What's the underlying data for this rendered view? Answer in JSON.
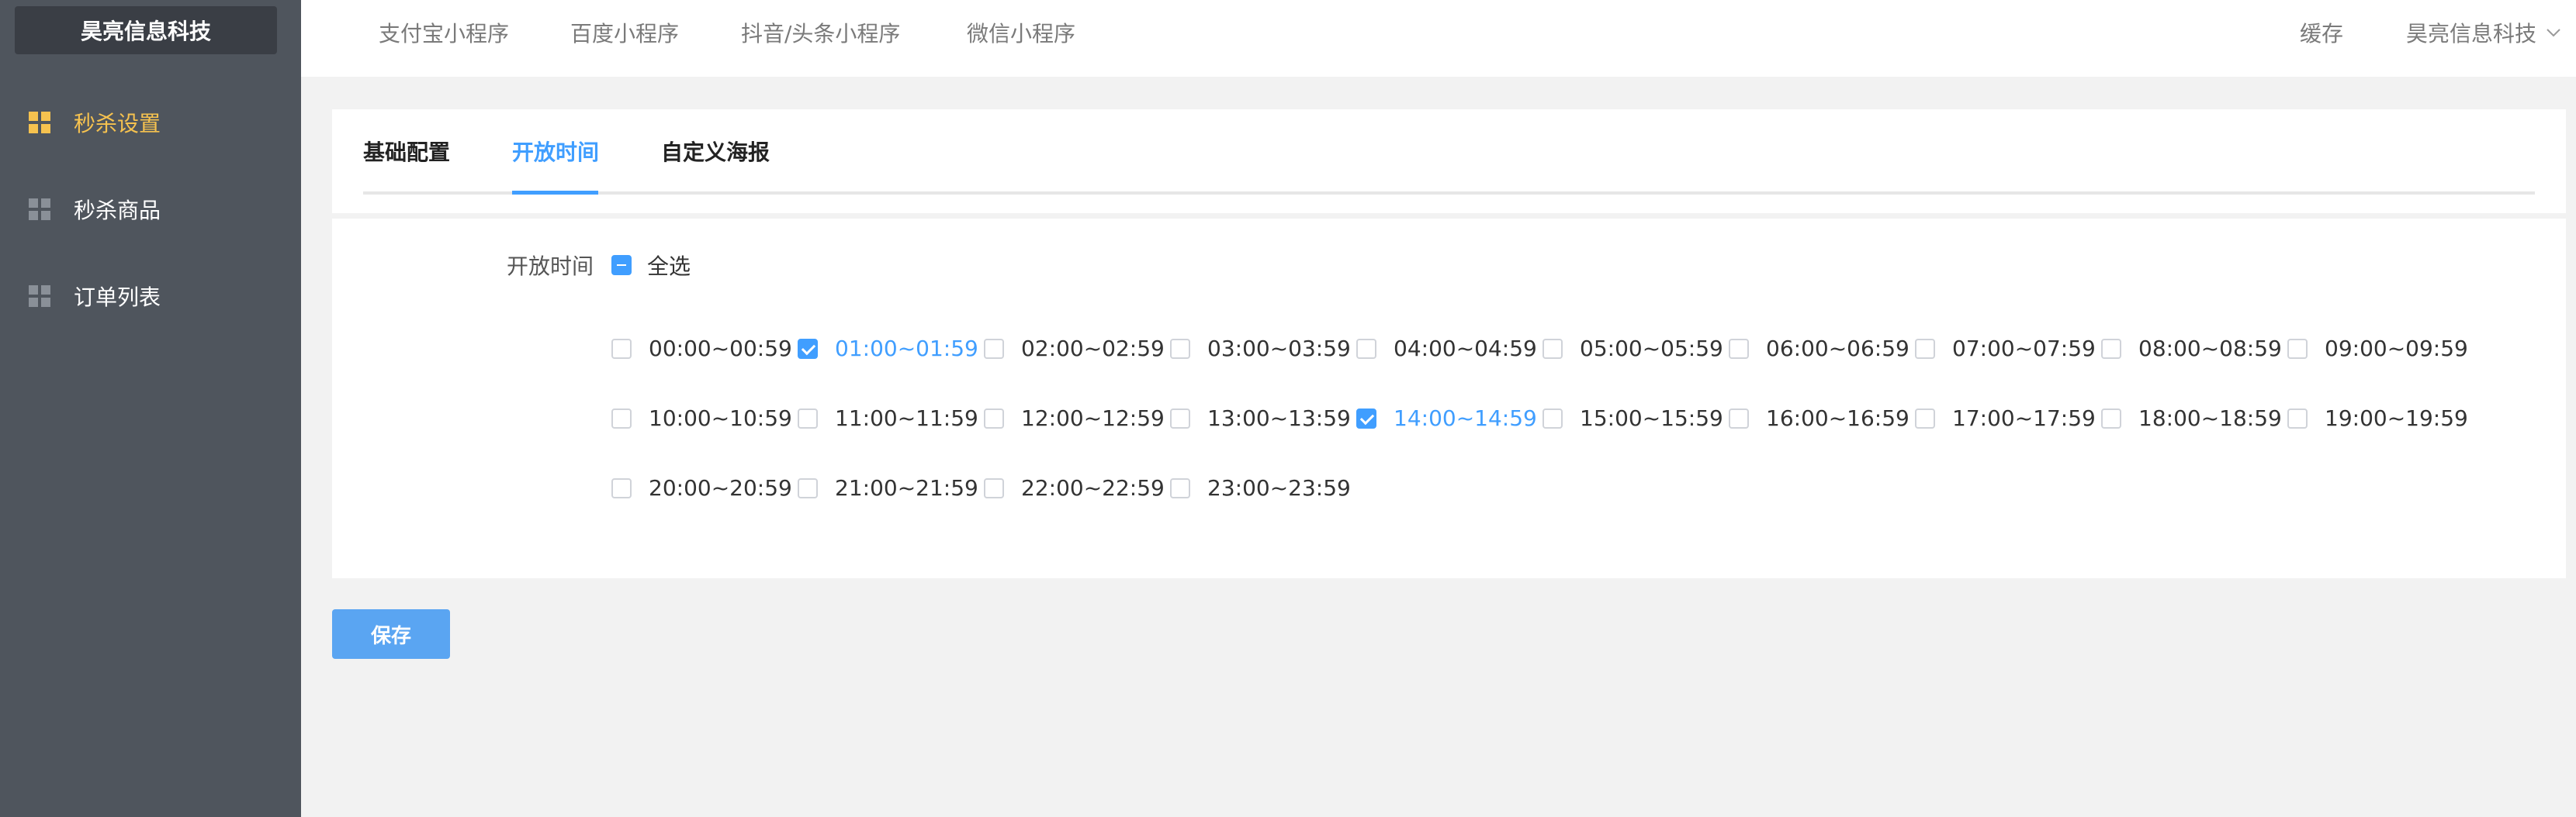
{
  "sidebar": {
    "brand": "昊亮信息科技",
    "items": [
      {
        "label": "秒杀设置",
        "icon": "grid-icon",
        "active": true
      },
      {
        "label": "秒杀商品",
        "icon": "grid-icon",
        "active": false
      },
      {
        "label": "订单列表",
        "icon": "grid-icon",
        "active": false
      }
    ]
  },
  "topbar": {
    "links": [
      "支付宝小程序",
      "百度小程序",
      "抖音/头条小程序",
      "微信小程序"
    ],
    "cache": "缓存",
    "user": "昊亮信息科技",
    "user_icon": "chevron-down-icon"
  },
  "tabs": [
    {
      "label": "基础配置",
      "active": false
    },
    {
      "label": "开放时间",
      "active": true
    },
    {
      "label": "自定义海报",
      "active": false
    }
  ],
  "form": {
    "label": "开放时间",
    "check_all": "全选",
    "check_all_state": "indeterminate",
    "slots": [
      {
        "label": "00:00~00:59",
        "checked": false
      },
      {
        "label": "01:00~01:59",
        "checked": true
      },
      {
        "label": "02:00~02:59",
        "checked": false
      },
      {
        "label": "03:00~03:59",
        "checked": false
      },
      {
        "label": "04:00~04:59",
        "checked": false
      },
      {
        "label": "05:00~05:59",
        "checked": false
      },
      {
        "label": "06:00~06:59",
        "checked": false
      },
      {
        "label": "07:00~07:59",
        "checked": false
      },
      {
        "label": "08:00~08:59",
        "checked": false
      },
      {
        "label": "09:00~09:59",
        "checked": false
      },
      {
        "label": "10:00~10:59",
        "checked": false
      },
      {
        "label": "11:00~11:59",
        "checked": false
      },
      {
        "label": "12:00~12:59",
        "checked": false
      },
      {
        "label": "13:00~13:59",
        "checked": false
      },
      {
        "label": "14:00~14:59",
        "checked": true
      },
      {
        "label": "15:00~15:59",
        "checked": false
      },
      {
        "label": "16:00~16:59",
        "checked": false
      },
      {
        "label": "17:00~17:59",
        "checked": false
      },
      {
        "label": "18:00~18:59",
        "checked": false
      },
      {
        "label": "19:00~19:59",
        "checked": false
      },
      {
        "label": "20:00~20:59",
        "checked": false
      },
      {
        "label": "21:00~21:59",
        "checked": false
      },
      {
        "label": "22:00~22:59",
        "checked": false
      },
      {
        "label": "23:00~23:59",
        "checked": false
      }
    ]
  },
  "save_label": "保存",
  "colors": {
    "sidebar_bg": "#4f555d",
    "brand_bg": "#3a3e45",
    "active_menu": "#f6c24f",
    "accent": "#409eff",
    "save_button": "#5aa5f2"
  }
}
